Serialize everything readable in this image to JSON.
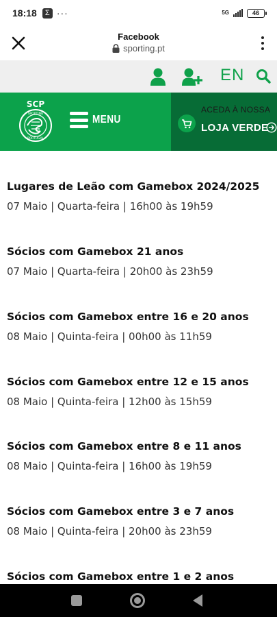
{
  "status_bar": {
    "time": "18:18",
    "network": "5G",
    "battery": "46"
  },
  "browser": {
    "title": "Facebook",
    "url": "sporting.pt"
  },
  "utility": {
    "language": "EN"
  },
  "header": {
    "logo_text_top": "SCP",
    "logo_text_ring_top": "SPORTING",
    "logo_text_ring_bottom": "PORTUGAL",
    "menu_label": "MENU",
    "shop_line1": "ACEDA À NOSSA",
    "shop_line2": "LOJA VERDE"
  },
  "events": [
    {
      "title": "Lugares de Leão com Gamebox 2024/2025",
      "detail": "07 Maio | Quarta-feira | 16h00 às 19h59"
    },
    {
      "title": "Sócios com Gamebox 21 anos",
      "detail": "07 Maio | Quarta-feira | 20h00 às 23h59"
    },
    {
      "title": "Sócios com Gamebox entre 16 e 20 anos",
      "detail": "08 Maio | Quinta-feira | 00h00 às 11h59"
    },
    {
      "title": "Sócios com Gamebox entre 12 e 15 anos",
      "detail": "08 Maio | Quinta-feira | 12h00 às 15h59"
    },
    {
      "title": "Sócios com Gamebox entre 8 e 11 anos",
      "detail": "08 Maio | Quinta-feira | 16h00 às 19h59"
    },
    {
      "title": "Sócios com Gamebox entre 3 e 7 anos",
      "detail": "08 Maio | Quinta-feira | 20h00 às 23h59"
    },
    {
      "title": "Sócios com Gamebox entre 1 e 2 anos",
      "detail": ""
    }
  ],
  "colors": {
    "brand_green": "#0ca24b",
    "dark_green": "#076c36",
    "utility_bg": "#efefef"
  },
  "icons": {
    "close": "close-icon",
    "lock": "lock-icon",
    "more": "more-vertical-icon",
    "user": "user-icon",
    "add_user": "add-user-icon",
    "search": "search-icon",
    "cart": "cart-icon",
    "arrow": "arrow-right-circle-icon"
  }
}
